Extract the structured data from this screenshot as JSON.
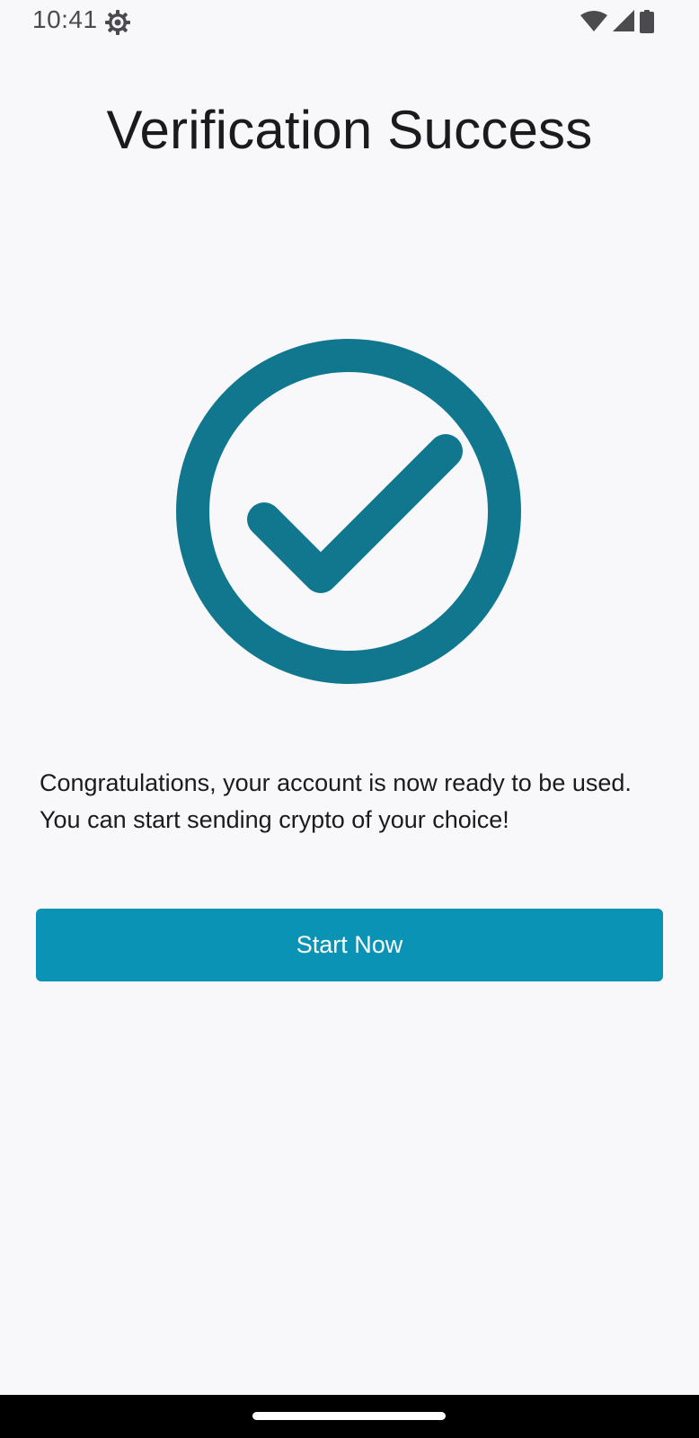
{
  "status_bar": {
    "time": "10:41",
    "icons": [
      "settings-gear-icon",
      "wifi-icon",
      "cellular-signal-icon",
      "battery-icon"
    ]
  },
  "title": "Verification Success",
  "graphic": {
    "icon": "checkmark-circle-icon",
    "color": "#10778f"
  },
  "message": {
    "line1": "Congratulations, your account is now ready to be used.",
    "line2": "You can start sending crypto of your choice!"
  },
  "button": {
    "label": "Start Now",
    "color": "#0a93b5"
  }
}
